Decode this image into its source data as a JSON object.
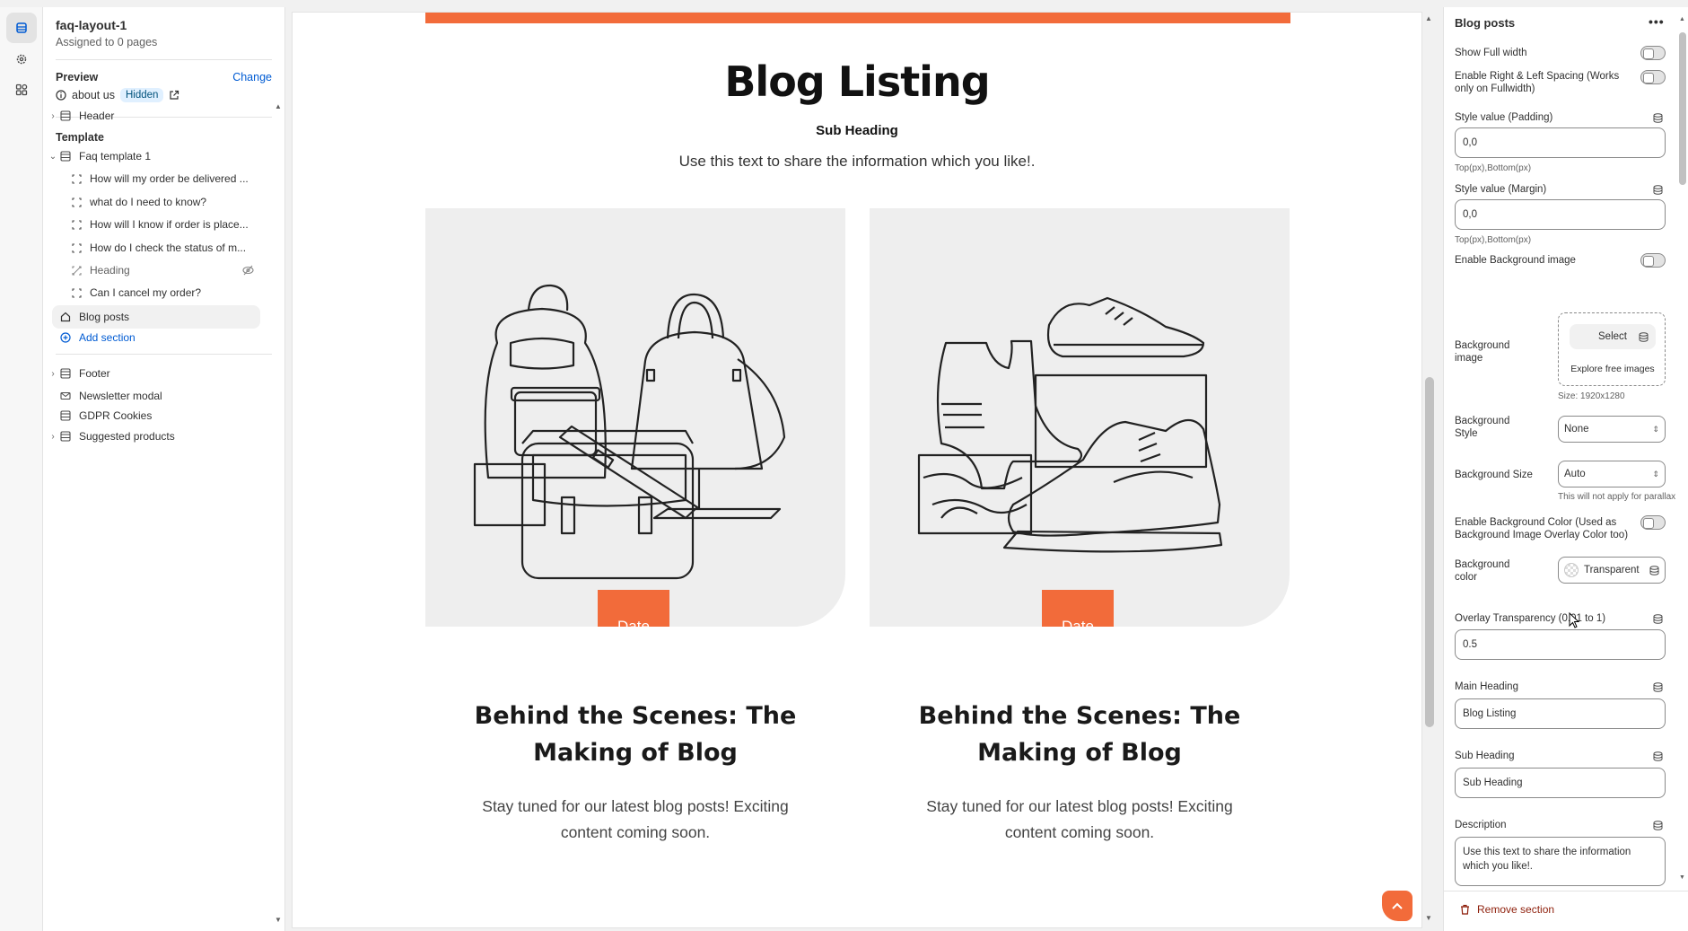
{
  "sidebar": {
    "title": "faq-layout-1",
    "subtitle": "Assigned to 0 pages",
    "preview_label": "Preview",
    "change_label": "Change",
    "preview_page": "about us",
    "preview_badge": "Hidden",
    "header_label": "Header",
    "template_label": "Template",
    "template_name": "Faq template 1",
    "blocks": [
      "How will my order be delivered ...",
      "what do I need to know?",
      "How will I know if order is place...",
      "How do I check the status of m...",
      "Heading",
      "Can I cancel my order?"
    ],
    "selected_section": "Blog posts",
    "add_section": "Add section",
    "footer_items": [
      "Footer",
      "Newsletter modal",
      "GDPR Cookies",
      "Suggested products"
    ]
  },
  "canvas": {
    "title": "Blog Listing",
    "sub_heading": "Sub Heading",
    "description": "Use this text to share the information which you like!.",
    "accent_color": "#f26b3a",
    "cards": [
      {
        "date": "Date",
        "title": "Behind the Scenes: The Making of Blog",
        "text": "Stay tuned for our latest blog posts! Exciting content coming soon."
      },
      {
        "date": "Date",
        "title": "Behind the Scenes: The Making of Blog",
        "text": "Stay tuned for our latest blog posts! Exciting content coming soon."
      }
    ]
  },
  "panel": {
    "title": "Blog posts",
    "more": "•••",
    "show_full_width": "Show Full width",
    "enable_spacing": "Enable Right & Left Spacing (Works only on Fullwidth)",
    "padding_label": "Style value (Padding)",
    "padding_value": "0,0",
    "padding_help": "Top(px),Bottom(px)",
    "margin_label": "Style value (Margin)",
    "margin_value": "0,0",
    "margin_help": "Top(px),Bottom(px)",
    "enable_bg_image": "Enable Background image",
    "bg_image_label": "Background image",
    "select_label": "Select",
    "explore_label": "Explore free images",
    "size_help": "Size: 1920x1280",
    "bg_style_label": "Background Style",
    "bg_style_value": "None",
    "bg_size_label": "Background Size",
    "bg_size_value": "Auto",
    "parallax_help": "This will not apply for parallax",
    "enable_bg_color": "Enable Background Color (Used as Background Image Overlay Color too)",
    "bg_color_label": "Background color",
    "bg_color_value": "Transparent",
    "overlay_label": "Overlay Transparency (0.01 to 1)",
    "overlay_value": "0.5",
    "main_heading_label": "Main Heading",
    "main_heading_value": "Blog Listing",
    "sub_heading_label": "Sub Heading",
    "sub_heading_value": "Sub Heading",
    "description_label": "Description",
    "description_value": "Use this text to share the information which you like!.",
    "remove_label": "Remove section"
  }
}
